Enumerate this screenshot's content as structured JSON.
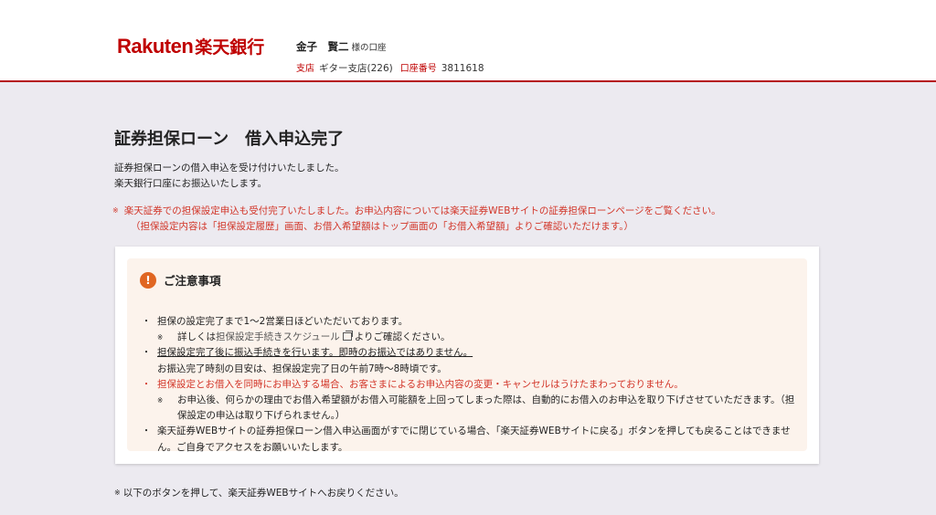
{
  "header": {
    "logo_text": "Rakuten",
    "logo_jp": "楽天銀行",
    "account_name": "金子　賢二",
    "account_suffix": "様の口座",
    "branch_label": "支店",
    "branch_value": "ギター支店(226)",
    "account_no_label": "口座番号",
    "account_no_value": "3811618"
  },
  "main": {
    "title": "証券担保ローン　借入申込完了",
    "intro_line1": "証券担保ローンの借入申込を受け付けいたしました。",
    "intro_line2": "楽天銀行口座にお振込いたします。",
    "note_mark": "※",
    "note_line1": "楽天証券での担保設定申込も受付完了いたしました。お申込内容については楽天証券WEBサイトの証券担保ローンページをご覧ください。",
    "note_line2": "（担保設定内容は「担保設定履歴」画面、お借入希望額はトップ画面の「お借入希望額」よりご確認いただけます。）"
  },
  "notice": {
    "title": "ご注意事項",
    "item1": "担保の設定完了まで1〜2営業日ほどいただいております。",
    "item1_sub_prefix": "詳しくは",
    "item1_sub_link": "担保設定手続きスケジュール",
    "item1_sub_suffix": "よりご確認ください。",
    "item2_line1": "担保設定完了後に振込手続きを行います。即時のお振込ではありません。",
    "item2_line2": "お振込完了時刻の目安は、担保設定完了日の午前7時〜8時頃です。",
    "item3": "担保設定とお借入を同時にお申込する場合、お客さまによるお申込内容の変更・キャンセルはうけたまわっておりません。",
    "item3_sub": "お申込後、何らかの理由でお借入希望額がお借入可能額を上回ってしまった際は、自動的にお借入のお申込を取り下げさせていただきます。（担保設定の申込は取り下げられません。）",
    "item4": "楽天証券WEBサイトの証券担保ローン借入申込画面がすでに閉じている場合、「楽天証券WEBサイトに戻る」ボタンを押しても戻ることはできません。ご自身でアクセスをお願いいたします。"
  },
  "footer_note": "以下のボタンを押して、楽天証券WEBサイトへお戻りください。",
  "colors": {
    "brand_red": "#bf0000",
    "note_red": "#d23528",
    "warn_orange": "#e06622"
  },
  "icons": {
    "warning": "exclamation-circle-icon",
    "external": "external-window-icon"
  }
}
